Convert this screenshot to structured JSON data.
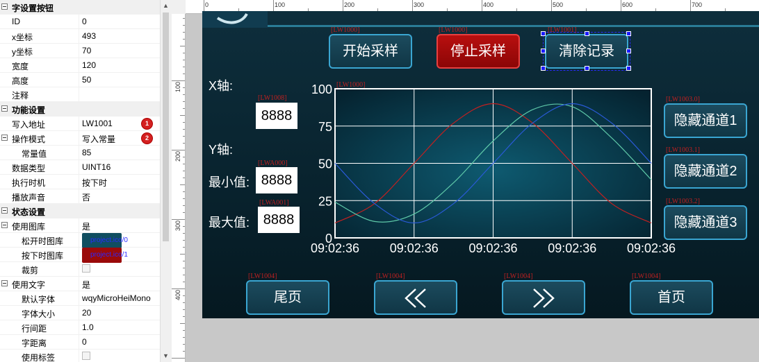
{
  "panel": {
    "rows": [
      {
        "type": "section",
        "key": "字设置按钮"
      },
      {
        "key": "ID",
        "val": "0"
      },
      {
        "key": "x坐标",
        "val": "493"
      },
      {
        "key": "y坐标",
        "val": "70"
      },
      {
        "key": "宽度",
        "val": "120"
      },
      {
        "key": "高度",
        "val": "50"
      },
      {
        "key": "注释",
        "val": ""
      },
      {
        "type": "section",
        "key": "功能设置"
      },
      {
        "key": "写入地址",
        "val": "LW1001",
        "badge": "1"
      },
      {
        "key": "操作模式",
        "val": "写入常量",
        "badge": "2",
        "tog": true
      },
      {
        "key": "常量值",
        "val": "85",
        "indent": true
      },
      {
        "key": "数据类型",
        "val": "UINT16"
      },
      {
        "key": "执行时机",
        "val": "按下时"
      },
      {
        "key": "播放声音",
        "val": "否"
      },
      {
        "type": "section",
        "key": "状态设置"
      },
      {
        "key": "使用图库",
        "val": "是",
        "tog": true
      },
      {
        "key": "松开时图库",
        "val": "project.ico/0",
        "indent": true,
        "swatch": "#104e60"
      },
      {
        "key": "按下时图库",
        "val": "project.ico/1",
        "indent": true,
        "swatch": "#9a0a0a"
      },
      {
        "key": "裁剪",
        "val": "",
        "indent": true,
        "check": true
      },
      {
        "key": "使用文字",
        "val": "是",
        "tog": true
      },
      {
        "key": "默认字体",
        "val": "wqyMicroHeiMono",
        "indent": true
      },
      {
        "key": "字体大小",
        "val": "20",
        "indent": true
      },
      {
        "key": "行间距",
        "val": "1.0",
        "indent": true
      },
      {
        "key": "字距离",
        "val": "0",
        "indent": true
      },
      {
        "key": "使用标签",
        "val": "",
        "indent": true,
        "check": true
      }
    ]
  },
  "ruler": {
    "top_labels": [
      "0",
      "100",
      "200",
      "300",
      "400",
      "500",
      "600",
      "700"
    ],
    "left_labels": [
      "100",
      "200",
      "300",
      "400"
    ]
  },
  "screen": {
    "buttons": {
      "start": {
        "label": "开始采样",
        "tag": "[LW1000]"
      },
      "stop": {
        "label": "停止采样",
        "tag": "[LW1000]"
      },
      "clear": {
        "label": "清除记录",
        "tag": "[LW1001]"
      },
      "hide1": {
        "label": "隐藏通道1",
        "tag": "[LW1003.0]"
      },
      "hide2": {
        "label": "隐藏通道2",
        "tag": "[LW1003.1]"
      },
      "hide3": {
        "label": "隐藏通道3",
        "tag": "[LW1003.2]"
      },
      "last": {
        "label": "尾页",
        "tag": "[LW1004]"
      },
      "prev": {
        "label": "《",
        "tag": "[LW1004]"
      },
      "next": {
        "label": "》",
        "tag": "[LW1004]"
      },
      "first": {
        "label": "首页",
        "tag": "[LW1004]"
      }
    },
    "x_axis_label": "X轴:",
    "y_axis_label": "Y轴:",
    "min_label": "最小值:",
    "max_label": "最大值:",
    "x_value": {
      "value": "8888",
      "tag": "[LW1008]"
    },
    "min_value": {
      "value": "8888",
      "tag": "[LWA000]"
    },
    "max_value": {
      "value": "8888",
      "tag": "[LWA001]"
    },
    "chart_tag": "[LW1000]"
  },
  "chart_data": {
    "type": "line",
    "title": "",
    "xlabel": "",
    "ylabel": "",
    "ylim": [
      0,
      100
    ],
    "y_ticks": [
      0,
      25,
      50,
      75,
      100
    ],
    "x_tick_labels": [
      "09:02:36",
      "09:02:36",
      "09:02:36",
      "09:02:36",
      "09:02:36"
    ],
    "x": [
      0,
      0.5,
      1,
      1.5,
      2,
      2.5,
      3,
      3.5,
      4
    ],
    "series": [
      {
        "color": "#c42020",
        "values": [
          10,
          23,
          50,
          77,
          90,
          77,
          50,
          23,
          10
        ]
      },
      {
        "color": "#5ec8a8",
        "values": [
          24,
          11,
          16,
          37,
          65,
          86,
          88,
          67,
          39
        ]
      },
      {
        "color": "#2a5ad8",
        "values": [
          50,
          23,
          10,
          23,
          50,
          77,
          90,
          77,
          50
        ]
      }
    ],
    "grid": true
  }
}
